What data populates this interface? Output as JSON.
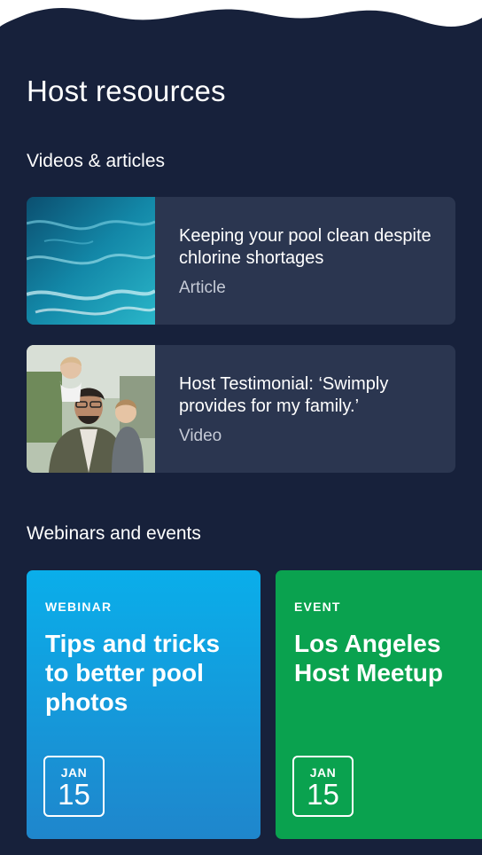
{
  "page": {
    "title": "Host resources"
  },
  "videos_section": {
    "title": "Videos & articles",
    "items": [
      {
        "title": "Keeping your pool clean despite chlorine shortages",
        "type": "Article",
        "thumbnail": "pool-water-image"
      },
      {
        "title": "Host Testimonial: ‘Swimply provides for my family.’",
        "type": "Video",
        "thumbnail": "family-photo-image"
      }
    ]
  },
  "events_section": {
    "title": "Webinars and events",
    "cards": [
      {
        "kind": "WEBINAR",
        "title": "Tips and tricks to better pool photos",
        "month": "JAN",
        "day": "15",
        "color_top": "#0aaeea",
        "color_bottom": "#1f86cc"
      },
      {
        "kind": "EVENT",
        "title": "Los Angeles Host Meetup",
        "month": "JAN",
        "day": "15",
        "color": "#0aa24f"
      }
    ]
  },
  "colors": {
    "background": "#17213b",
    "card": "#2b3650",
    "top_wave": "#ffffff"
  }
}
